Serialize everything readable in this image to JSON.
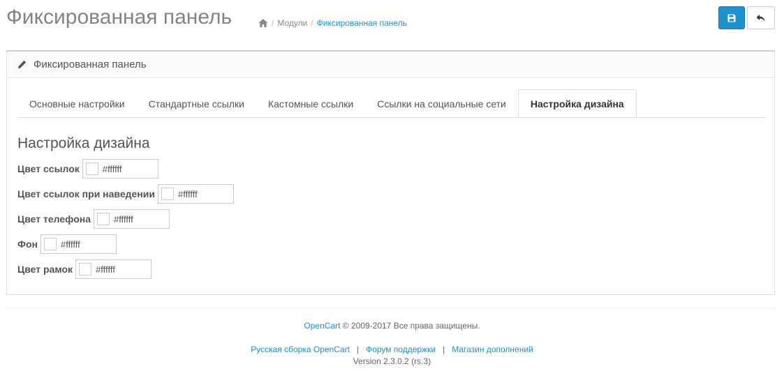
{
  "header": {
    "title": "Фиксированная панель",
    "breadcrumb": [
      {
        "label": "Модули"
      },
      {
        "label": "Фиксированная панель"
      }
    ]
  },
  "icons": {
    "home": "home-icon",
    "save": "floppy-disk-icon",
    "back": "reply-arrow-icon",
    "edit": "pencil-icon"
  },
  "colors": {
    "accent": "#1e91cf",
    "title": "#848484"
  },
  "panel": {
    "heading": "Фиксированная панель",
    "tabs": [
      {
        "label": "Основные настройки"
      },
      {
        "label": "Стандартные ссылки"
      },
      {
        "label": "Кастомные ссылки"
      },
      {
        "label": "Ссылки на социальные сети"
      },
      {
        "label": "Настройка дизайна"
      }
    ],
    "active_tab": "Настройка дизайна",
    "section_title": "Настройка дизайна",
    "fields": [
      {
        "label": "Цвет ссылок",
        "value": "#ffffff"
      },
      {
        "label": "Цвет ссылок при наведении",
        "value": "#ffffff"
      },
      {
        "label": "Цвет телефона",
        "value": "#ffffff"
      },
      {
        "label": "Фон",
        "value": "#ffffff"
      },
      {
        "label": "Цвет рамок",
        "value": "#ffffff"
      }
    ]
  },
  "footer": {
    "brand_link": "OpenCart",
    "copyright": "© 2009-2017 Все права защищены.",
    "links": [
      {
        "label": "Русская сборка OpenCart"
      },
      {
        "label": "Форум поддержки"
      },
      {
        "label": "Магазин дополнений"
      }
    ],
    "separator": "|",
    "version": "Version 2.3.0.2 (rs.3)"
  }
}
